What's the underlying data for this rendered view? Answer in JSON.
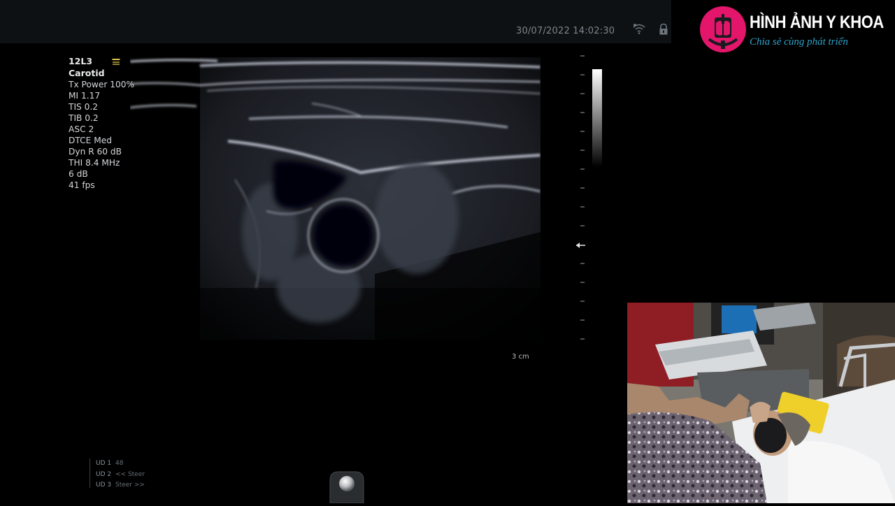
{
  "header": {
    "datetime": "30/07/2022 14:02:30"
  },
  "icons": {
    "wifi": "wifi-icon",
    "lock": "lock-icon",
    "probe": "probe-icon",
    "trackball": "trackball-icon",
    "logo": "lungs-logo-icon"
  },
  "params": {
    "probe": "12L3",
    "preset": "Carotid",
    "tx_power": "Tx Power 100%",
    "mi": "MI 1.17",
    "tis": "TIS 0.2",
    "tib": "TIB 0.2",
    "asc": "ASC 2",
    "dtce": "DTCE Med",
    "dyn_r": "Dyn R 60 dB",
    "thi": "THI 8.4 MHz",
    "gain": "6 dB",
    "fps": "41 fps"
  },
  "depth_label": "3 cm",
  "ud": [
    {
      "key": "UD 1",
      "value": "48"
    },
    {
      "key": "UD 2",
      "value": "<< Steer"
    },
    {
      "key": "UD 3",
      "value": "Steer >>"
    }
  ],
  "logo": {
    "title": "HÌNH ẢNH Y KHOA",
    "subtitle": "Chia sẻ cùng phát triển"
  },
  "colors": {
    "logo_pink": "#e3166c",
    "logo_sub": "#2fa3c9",
    "topbar": "#0d1114"
  }
}
